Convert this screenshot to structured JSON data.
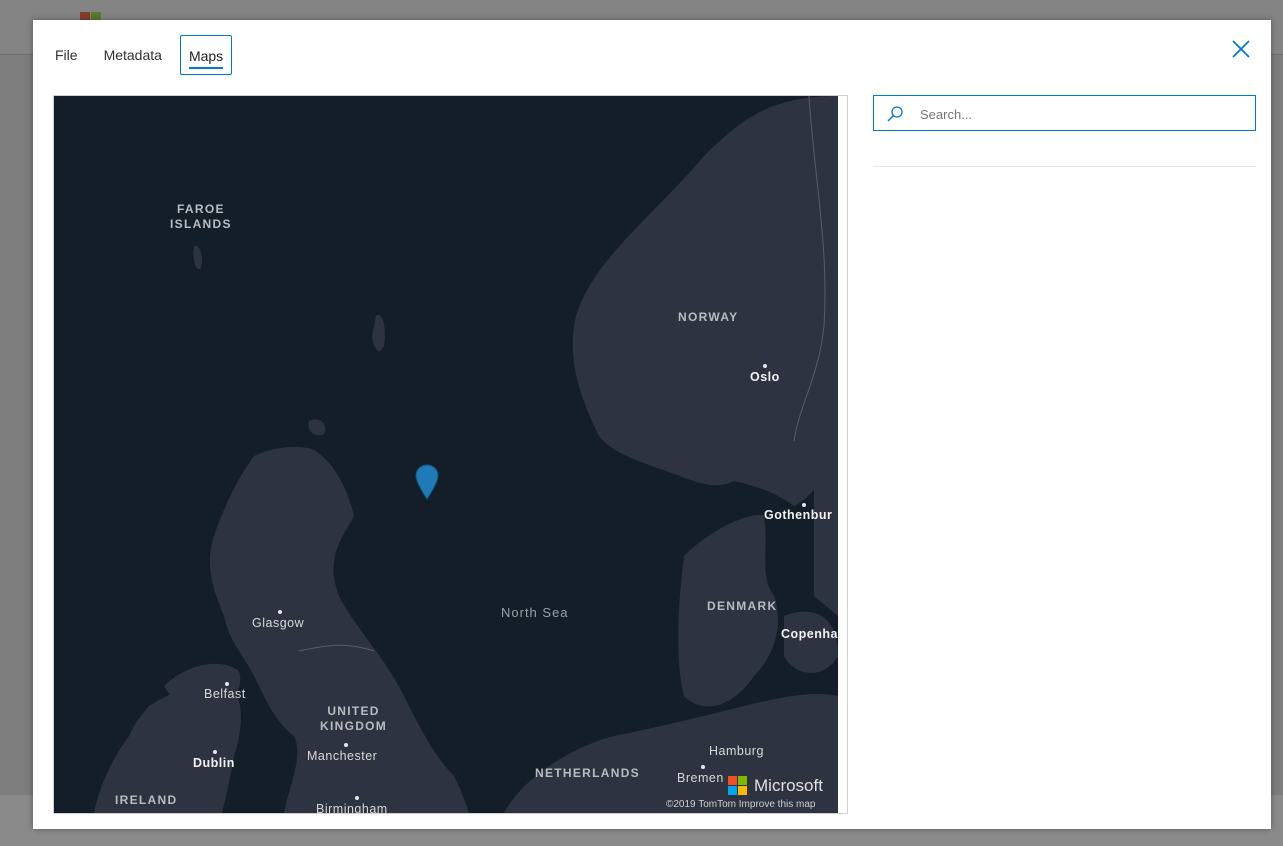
{
  "tabs": [
    {
      "label": "File",
      "active": false
    },
    {
      "label": "Metadata",
      "active": false
    },
    {
      "label": "Maps",
      "active": true
    }
  ],
  "search": {
    "placeholder": "Search...",
    "value": ""
  },
  "map": {
    "labels": {
      "faroe": "FAROE\nISLANDS",
      "norway": "NORWAY",
      "oslo": "Oslo",
      "gothenburg": "Gothenbur",
      "north_sea": "North Sea",
      "denmark": "DENMARK",
      "copenhagen": "Copenha",
      "glasgow": "Glasgow",
      "belfast": "Belfast",
      "uk": "UNITED\nKINGDOM",
      "manchester": "Manchester",
      "dublin": "Dublin",
      "ireland": "IRELAND",
      "birmingham": "Birmingham",
      "netherlands": "NETHERLANDS",
      "hamburg": "Hamburg",
      "bremen": "Bremen"
    },
    "brand": "Microsoft",
    "attribution": "©2019 TomTom  Improve this map",
    "pin_color": "#1f7ab8"
  },
  "colors": {
    "accent": "#0078d4",
    "map_water": "#131e28",
    "map_land": "#2d3340"
  }
}
